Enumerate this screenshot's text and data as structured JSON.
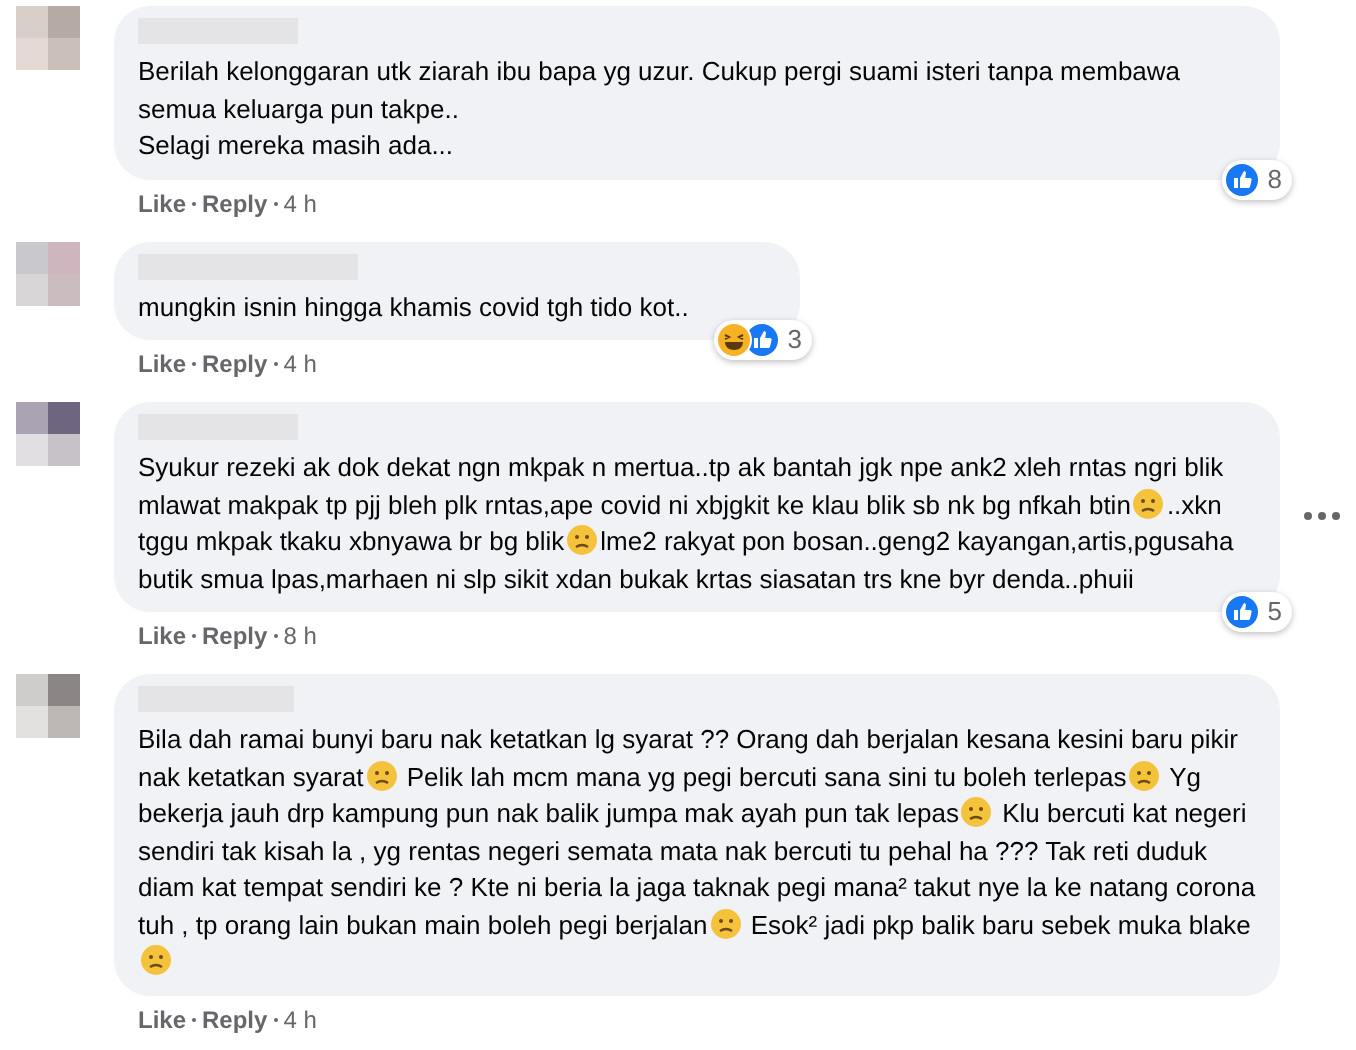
{
  "comments": [
    {
      "body": [
        [
          {
            "kind": "text",
            "text": "Berilah kelonggaran utk ziarah ibu bapa yg uzur. Cukup pergi suami isteri tanpa membawa semua keluarga pun takpe.."
          }
        ],
        [
          {
            "kind": "text",
            "text": "Selagi mereka masih ada..."
          }
        ]
      ],
      "actions": [
        "Like",
        "Reply"
      ],
      "time": "4 h",
      "reactions": [
        {
          "kind": "like"
        }
      ],
      "reaction_count": "8",
      "menu": false
    },
    {
      "body": [
        [
          {
            "kind": "text",
            "text": "mungkin isnin hingga khamis covid tgh tido kot.."
          }
        ]
      ],
      "actions": [
        "Like",
        "Reply"
      ],
      "time": "4 h",
      "reactions": [
        {
          "kind": "haha"
        },
        {
          "kind": "like"
        }
      ],
      "reaction_count": "3",
      "menu": false
    },
    {
      "body": [
        [
          {
            "kind": "text",
            "text": "Syukur rezeki ak dok dekat ngn mkpak n mertua..tp ak bantah jgk npe ank2 xleh rntas ngri blik mlawat makpak tp pjj bleh plk rntas,ape covid ni xbjgkit ke klau blik sb nk bg nfkah btin"
          },
          {
            "kind": "emoji"
          },
          {
            "kind": "text",
            "text": "..xkn tggu mkpak tkaku xbnyawa br bg blik"
          },
          {
            "kind": "emoji"
          },
          {
            "kind": "text",
            "text": "lme2 rakyat pon bosan..geng2 kayangan,artis,pgusaha butik smua lpas,marhaen ni slp sikit xdan bukak krtas siasatan trs kne byr denda..phuii"
          }
        ]
      ],
      "actions": [
        "Like",
        "Reply"
      ],
      "time": "8 h",
      "reactions": [
        {
          "kind": "like"
        }
      ],
      "reaction_count": "5",
      "menu": true
    },
    {
      "body": [
        [
          {
            "kind": "text",
            "text": "Bila dah ramai bunyi baru nak ketatkan lg syarat ?? Orang dah berjalan kesana kesini baru pikir nak ketatkan syarat"
          },
          {
            "kind": "emoji"
          },
          {
            "kind": "text",
            "text": " Pelik lah mcm mana yg pegi bercuti sana sini tu boleh terlepas"
          },
          {
            "kind": "emoji"
          },
          {
            "kind": "text",
            "text": " Yg bekerja jauh drp kampung pun nak balik jumpa mak ayah pun tak lepas"
          },
          {
            "kind": "emoji"
          },
          {
            "kind": "text",
            "text": " Klu bercuti kat negeri sendiri tak kisah la , yg rentas negeri semata mata nak bercuti tu pehal ha ??? Tak reti duduk diam kat tempat sendiri ke ? Kte ni beria la jaga taknak pegi mana² takut nye la ke natang corona tuh , tp orang lain bukan main boleh pegi berjalan"
          },
          {
            "kind": "emoji"
          },
          {
            "kind": "text",
            "text": " Esok² jadi pkp balik baru sebek muka blake"
          },
          {
            "kind": "emoji"
          }
        ]
      ],
      "actions": [
        "Like",
        "Reply"
      ],
      "time": "4 h",
      "menu": false
    }
  ]
}
